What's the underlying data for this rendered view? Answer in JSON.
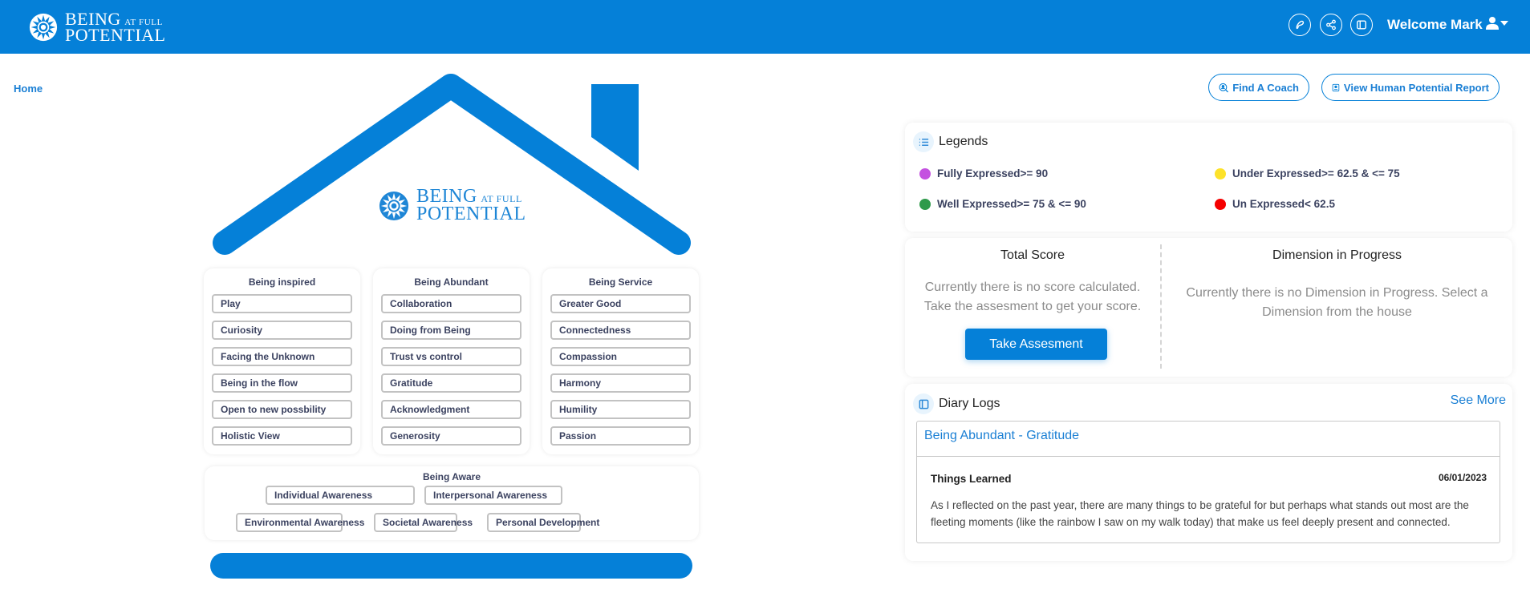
{
  "header": {
    "brand": {
      "line1": "BEING",
      "line1_small": "AT FULL",
      "line2": "POTENTIAL"
    },
    "icons": [
      "edit-icon",
      "share-icon",
      "sidebar-toggle-icon"
    ],
    "welcome": "Welcome Mark",
    "user_icon": "user-icon"
  },
  "breadcrumb": {
    "home": "Home"
  },
  "house": {
    "brand": {
      "line1": "BEING",
      "line1_small": "AT FULL",
      "line2": "POTENTIAL"
    },
    "columns": [
      {
        "title": "Being inspired",
        "items": [
          "Play",
          "Curiosity",
          "Facing the Unknown",
          "Being in the flow",
          "Open to new possbility",
          "Holistic View"
        ]
      },
      {
        "title": "Being Abundant",
        "items": [
          "Collaboration",
          "Doing from Being",
          "Trust vs control",
          "Gratitude",
          "Acknowledgment",
          "Generosity"
        ]
      },
      {
        "title": "Being Service",
        "items": [
          "Greater Good",
          "Connectedness",
          "Compassion",
          "Harmony",
          "Humility",
          "Passion"
        ]
      }
    ],
    "aware": {
      "title": "Being Aware",
      "row1": [
        "Individual Awareness",
        "Interpersonal Awareness"
      ],
      "row2": [
        "Environmental Awareness",
        "Societal Awareness",
        "Personal Development"
      ]
    }
  },
  "actions": {
    "find_coach": "Find A Coach",
    "view_report": "View Human Potential Report"
  },
  "legends": {
    "title": "Legends",
    "items": [
      {
        "label": "Fully Expressed>= 90",
        "color": "#c452e0"
      },
      {
        "label": "Well Expressed>= 75 & <= 90",
        "color": "#2e9a4a"
      },
      {
        "label": "Under Expressed>= 62.5 & <= 75",
        "color": "#fde22a"
      },
      {
        "label": "Un Expressed< 62.5",
        "color": "#f50000"
      }
    ]
  },
  "score": {
    "total_title": "Total Score",
    "total_text_1": "Currently there is no score calculated.",
    "total_text_2": "Take the assesment to get your score.",
    "take_button": "Take Assesment",
    "dimension_title": "Dimension in Progress",
    "dimension_text_1": "Currently there is no Dimension in Progress. Select a",
    "dimension_text_2": "Dimension from the house"
  },
  "diary": {
    "title": "Diary Logs",
    "see_more": "See More",
    "entry": {
      "title": "Being Abundant - Gratitude",
      "subtitle": "Things Learned",
      "date": "06/01/2023",
      "body": "As I reflected on the past year, there are many things to be grateful for but perhaps what stands out most are the fleeting moments (like the rainbow I saw on my walk today) that make us feel deeply present and connected."
    }
  },
  "colors": {
    "primary": "#0580d8",
    "link": "#1a7fd4"
  }
}
